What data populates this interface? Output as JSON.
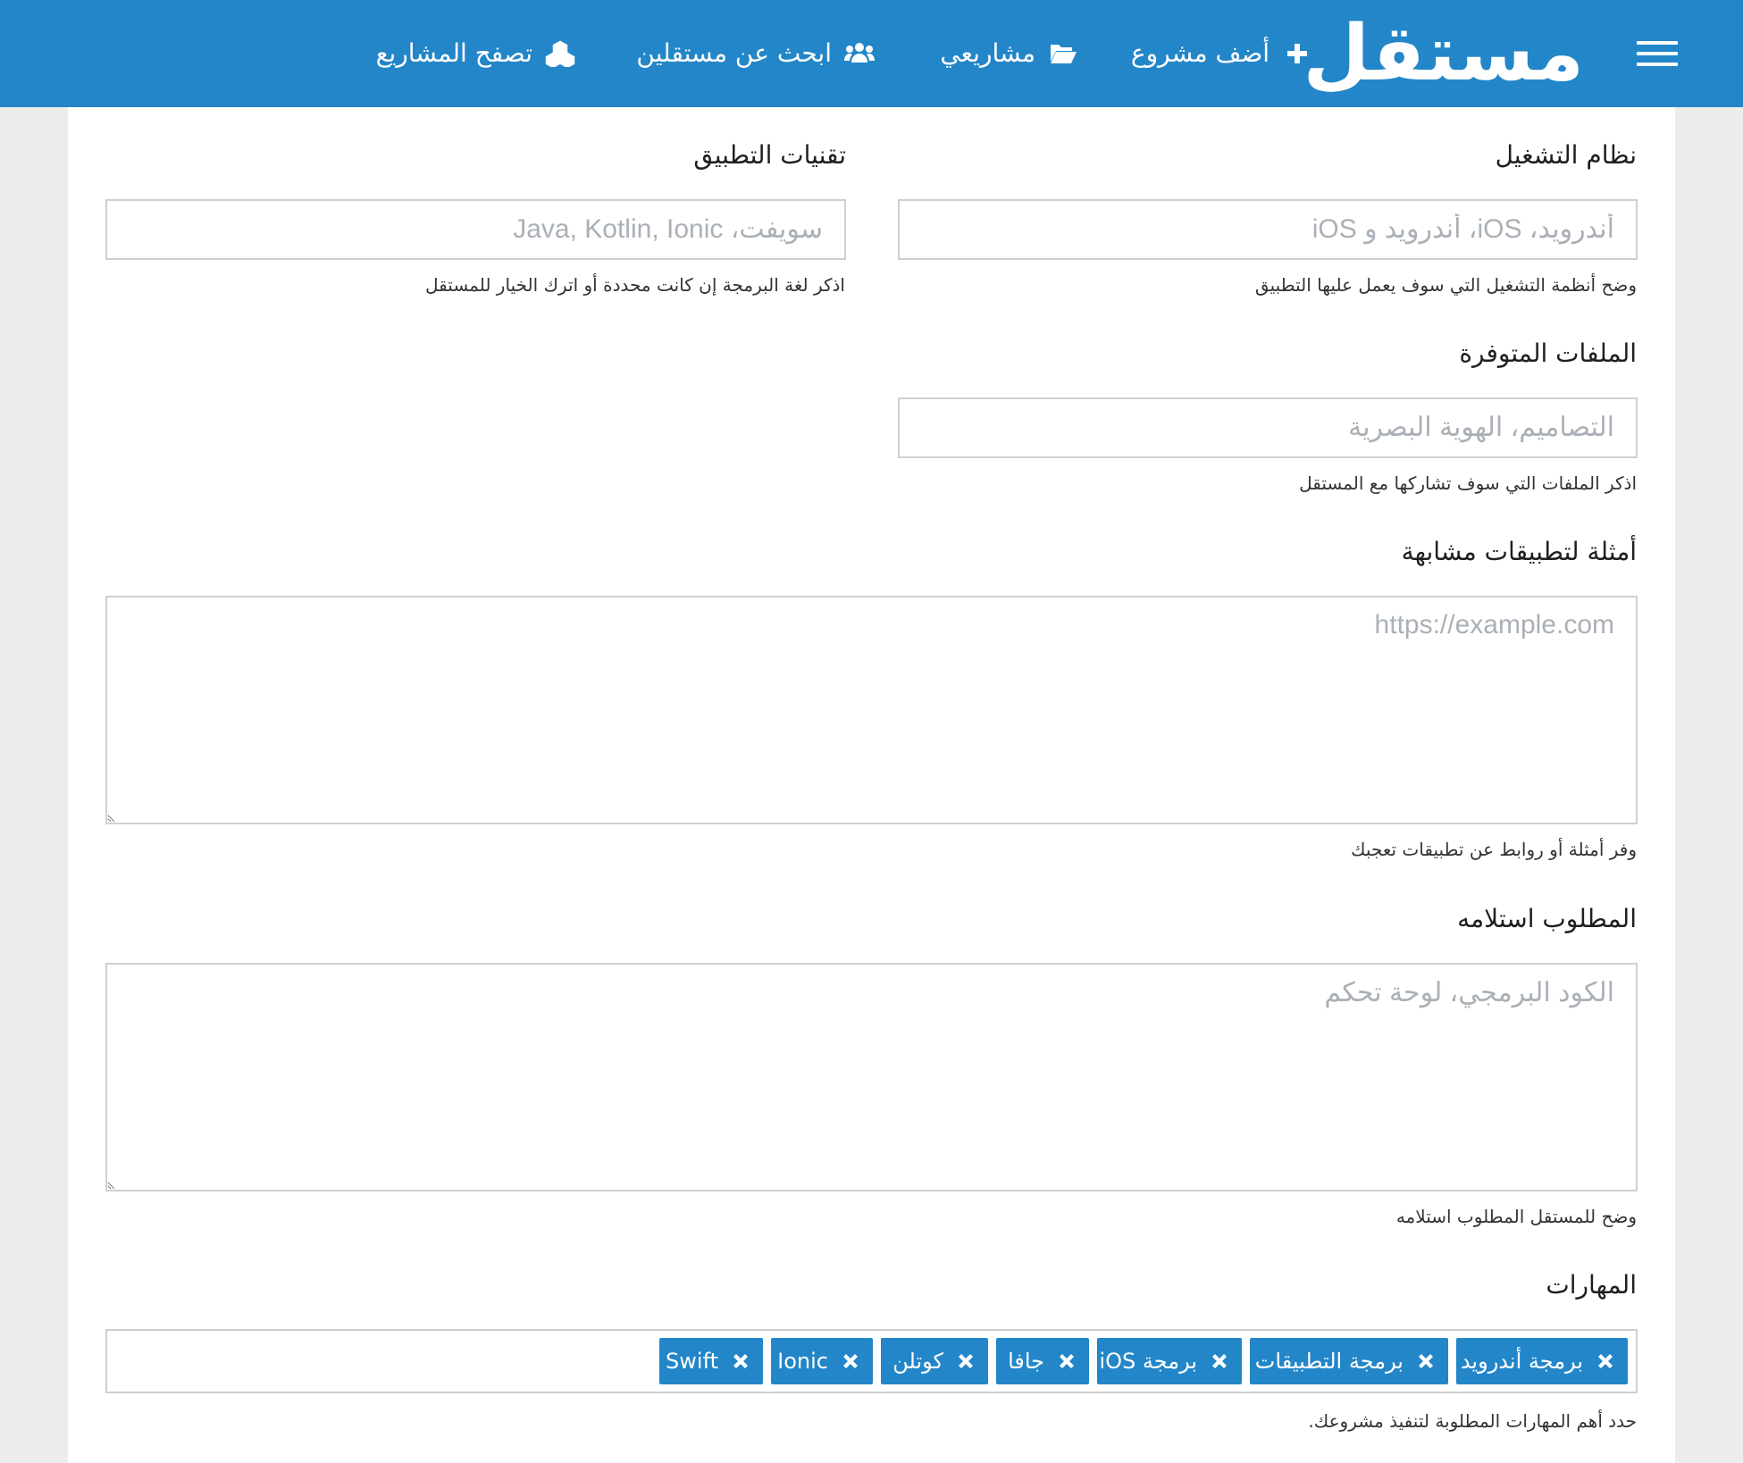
{
  "nav": {
    "logo": "مستقل",
    "add_project": "أضف مشروع",
    "my_projects": "مشاريعي",
    "find_freelancers": "ابحث عن مستقلين",
    "browse_projects": "تصفح المشاريع"
  },
  "form": {
    "os": {
      "label": "نظام التشغيل",
      "placeholder": "أندرويد، iOS، أندرويد و iOS",
      "help": "وضح أنظمة التشغيل التي سوف يعمل عليها التطبيق"
    },
    "tech": {
      "label": "تقنيات التطبيق",
      "placeholder": "سويفت، Java, Kotlin, Ionic",
      "help": "اذكر لغة البرمجة إن كانت محددة أو اترك الخيار للمستقل"
    },
    "files": {
      "label": "الملفات المتوفرة",
      "placeholder": "التصاميم، الهوية البصرية",
      "help": "اذكر الملفات التي سوف تشاركها مع المستقل"
    },
    "examples": {
      "label": "أمثلة لتطبيقات مشابهة",
      "placeholder": "https://example.com",
      "help": "وفر أمثلة أو روابط عن تطبيقات تعجبك"
    },
    "deliverables": {
      "label": "المطلوب استلامه",
      "placeholder": "الكود البرمجي، لوحة تحكم",
      "help": "وضح للمستقل المطلوب استلامه"
    },
    "skills": {
      "label": "المهارات",
      "help": "حدد أهم المهارات المطلوبة لتنفيذ مشروعك.",
      "tags": [
        "برمجة أندرويد",
        "برمجة التطبيقات",
        "برمجة iOS",
        "جافا",
        "كوتلن",
        "Ionic",
        "Swift"
      ]
    }
  },
  "colors": {
    "primary": "#2386c8",
    "background": "#ececec",
    "border": "#cfcfcf"
  }
}
